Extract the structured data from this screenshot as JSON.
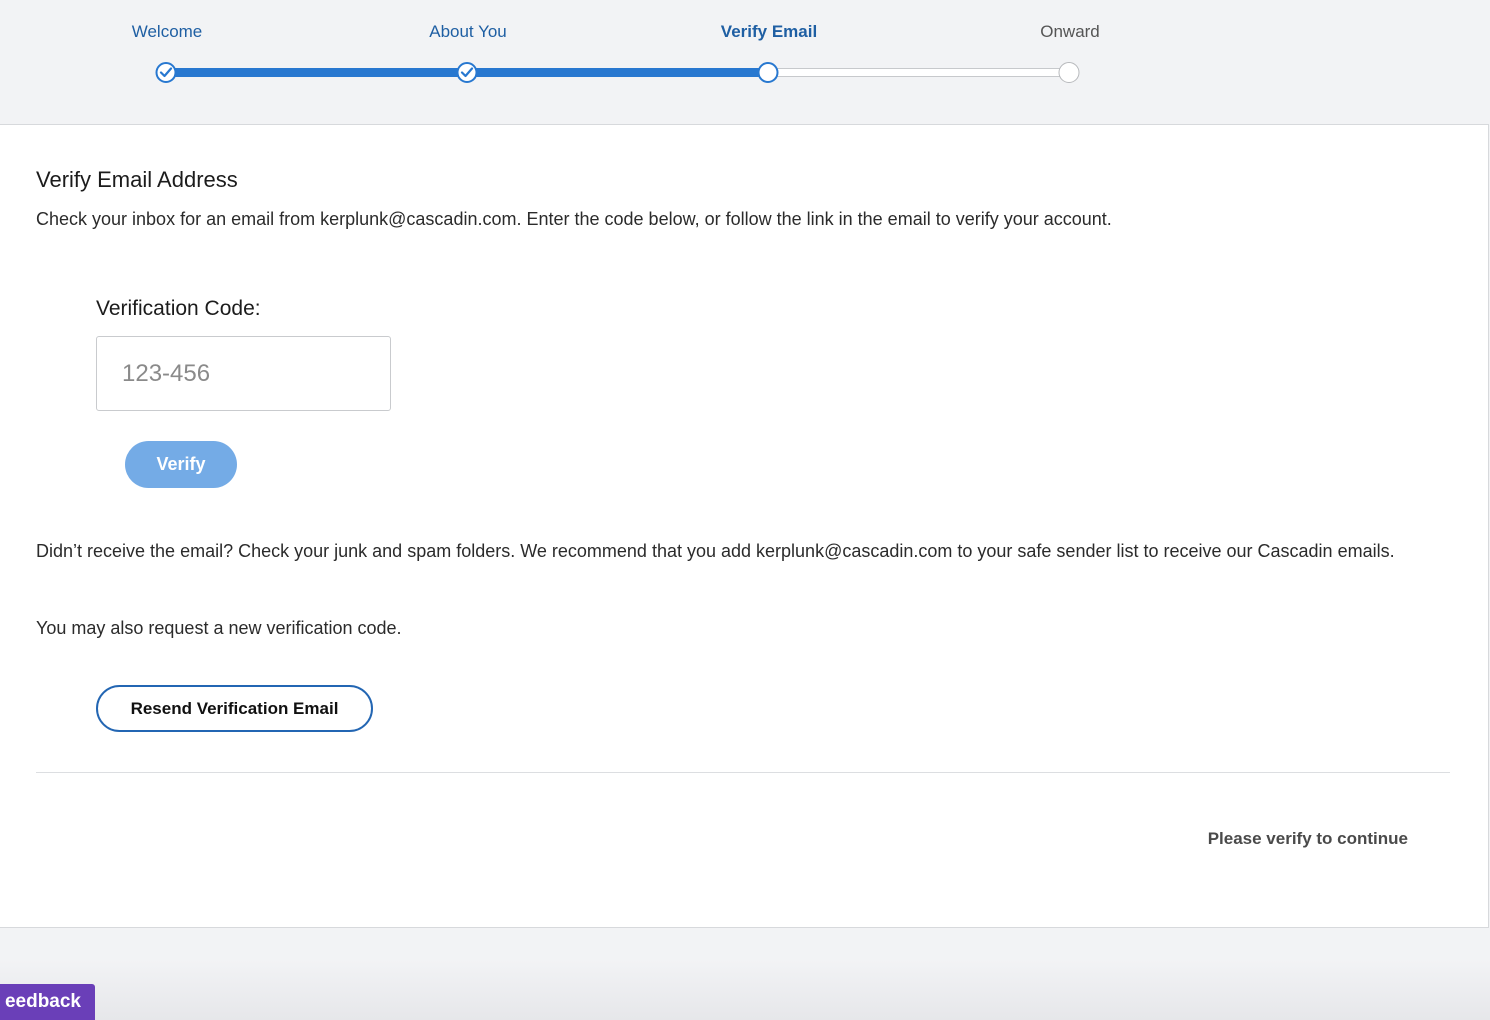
{
  "stepper": {
    "steps": [
      {
        "label": "Welcome",
        "state": "done"
      },
      {
        "label": "About You",
        "state": "done"
      },
      {
        "label": "Verify Email",
        "state": "current"
      },
      {
        "label": "Onward",
        "state": "upcoming"
      }
    ],
    "colors": {
      "active": "#2878d0",
      "label": "#1f5fa3",
      "upcoming": "#555555"
    }
  },
  "card": {
    "title": "Verify Email Address",
    "intro": "Check your inbox for an email from kerplunk@cascadin.com. Enter the code below, or follow the link in the email to verify your account.",
    "code_label": "Verification Code:",
    "code_placeholder": "123-456",
    "code_value": "",
    "verify_label": "Verify",
    "help_text": "Didn’t receive the email? Check your junk and spam folders. We recommend that you add kerplunk@cascadin.com to your safe sender list to receive our Cascadin emails.",
    "request_text": "You may also request a new verification code.",
    "resend_label": "Resend Verification Email",
    "continue_status": "Please verify to continue"
  },
  "feedback": {
    "label": "eedback",
    "color": "#6a3fb8"
  }
}
